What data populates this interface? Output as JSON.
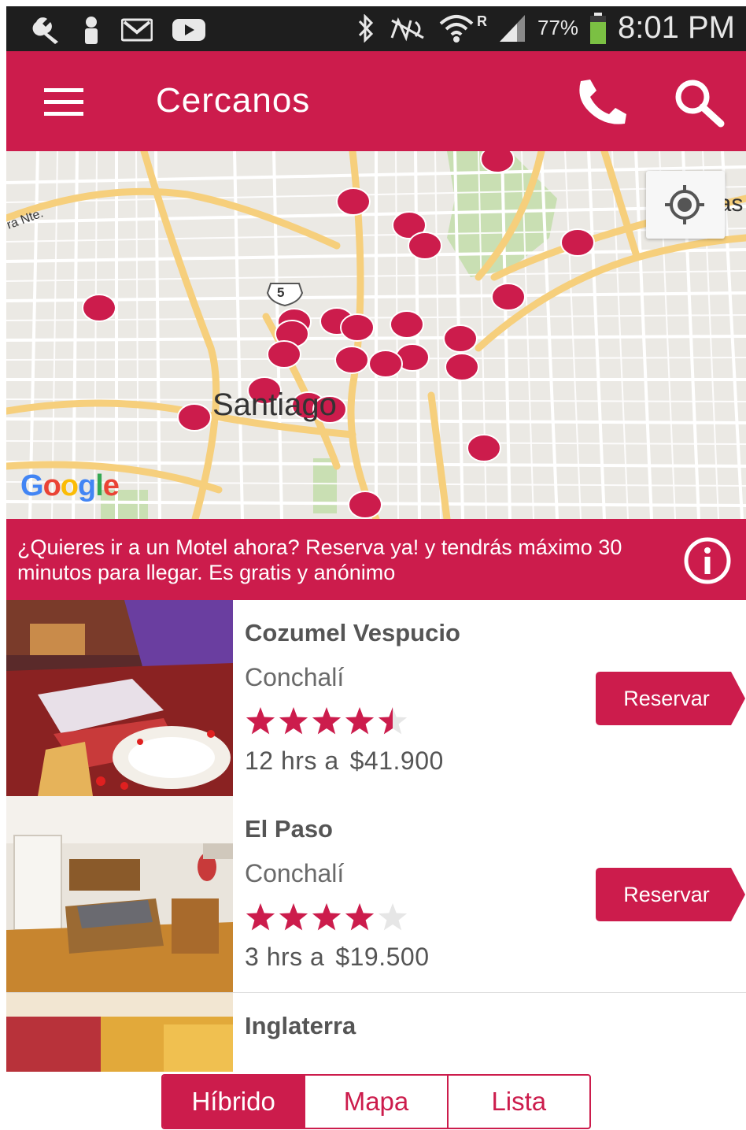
{
  "status_bar": {
    "battery": "77%",
    "time": "8:01 PM",
    "icons": [
      "wrench-icon",
      "person-icon",
      "gmail-icon",
      "youtube-icon",
      "bluetooth-icon",
      "nfc-icon",
      "wifi-icon",
      "signal-icon",
      "battery-icon"
    ],
    "roaming": "R"
  },
  "app_bar": {
    "title": "Cercanos",
    "icons": [
      "menu-icon",
      "phone-icon",
      "search-icon"
    ]
  },
  "map": {
    "labels": {
      "city": "Santiago",
      "route_shield": "5",
      "street_fragment": "ra Nte.",
      "district_fragment": "Las",
      "attribution": "Google"
    },
    "marker_color": "#cc1c4c",
    "locate_icon": "my-location-icon"
  },
  "promo": {
    "text": "¿Quieres ir a un Motel ahora? Reserva ya! y tendrás máximo 30 minutos para llegar. Es gratis y anónimo",
    "icon": "info-icon"
  },
  "listings": [
    {
      "name": "Cozumel Vespucio",
      "district": "Conchalí",
      "rating": 4.5,
      "duration": "12 hrs a",
      "price": "$41.900",
      "button": "Reservar"
    },
    {
      "name": "El Paso",
      "district": "Conchalí",
      "rating": 4,
      "duration": "3 hrs a",
      "price": "$19.500",
      "button": "Reservar"
    },
    {
      "name": "Inglaterra"
    }
  ],
  "view_tabs": {
    "items": [
      "Híbrido",
      "Mapa",
      "Lista"
    ],
    "selected": "Híbrido"
  },
  "colors": {
    "brand": "#cc1c4c",
    "status_bar": "#1e1e1e",
    "text_gray": "#555555"
  }
}
